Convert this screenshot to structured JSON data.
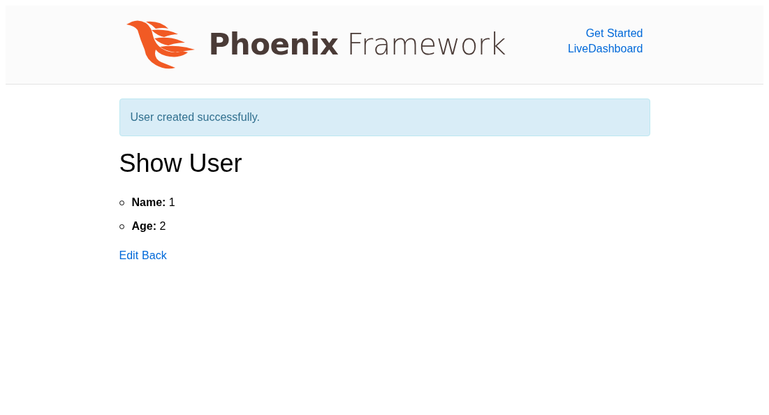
{
  "header": {
    "logo": {
      "bold": "Phoenix",
      "light": "Framework"
    },
    "nav": [
      "Get Started",
      "LiveDashboard"
    ]
  },
  "alert": "User created successfully.",
  "title": "Show User",
  "fields": [
    "**Name:** 1",
    "**Age:** 2"
  ],
  "links": [
    "Edit",
    "Back"
  ]
}
